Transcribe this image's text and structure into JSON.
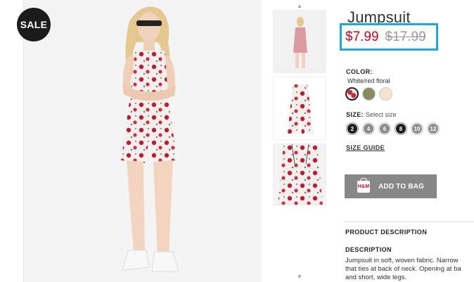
{
  "badge": {
    "sale": "SALE"
  },
  "product": {
    "title": "Jumpsuit",
    "price_current": "$7.99",
    "price_original": "$17.99"
  },
  "color": {
    "label": "COLOR:",
    "selected_value": "White/red floral",
    "swatches": [
      "white-red-floral",
      "olive",
      "light-peach"
    ]
  },
  "size": {
    "label": "SIZE:",
    "hint": "Select size",
    "options": [
      "2",
      "4",
      "6",
      "8",
      "10",
      "12"
    ],
    "guide_link": "SIZE GUIDE"
  },
  "actions": {
    "add_to_bag": "ADD TO BAG",
    "bag_icon_text": "H&M"
  },
  "description": {
    "section_title": "PRODUCT DESCRIPTION",
    "heading": "DESCRIPTION",
    "lines": [
      "Jumpsuit in soft, woven fabric. Narrow",
      "that ties at back of neck. Opening at ba",
      "and short, wide legs."
    ]
  },
  "colors": {
    "accent_highlight": "#1aa9d8",
    "sale_price": "#d0021b",
    "button_bg": "#878787"
  }
}
